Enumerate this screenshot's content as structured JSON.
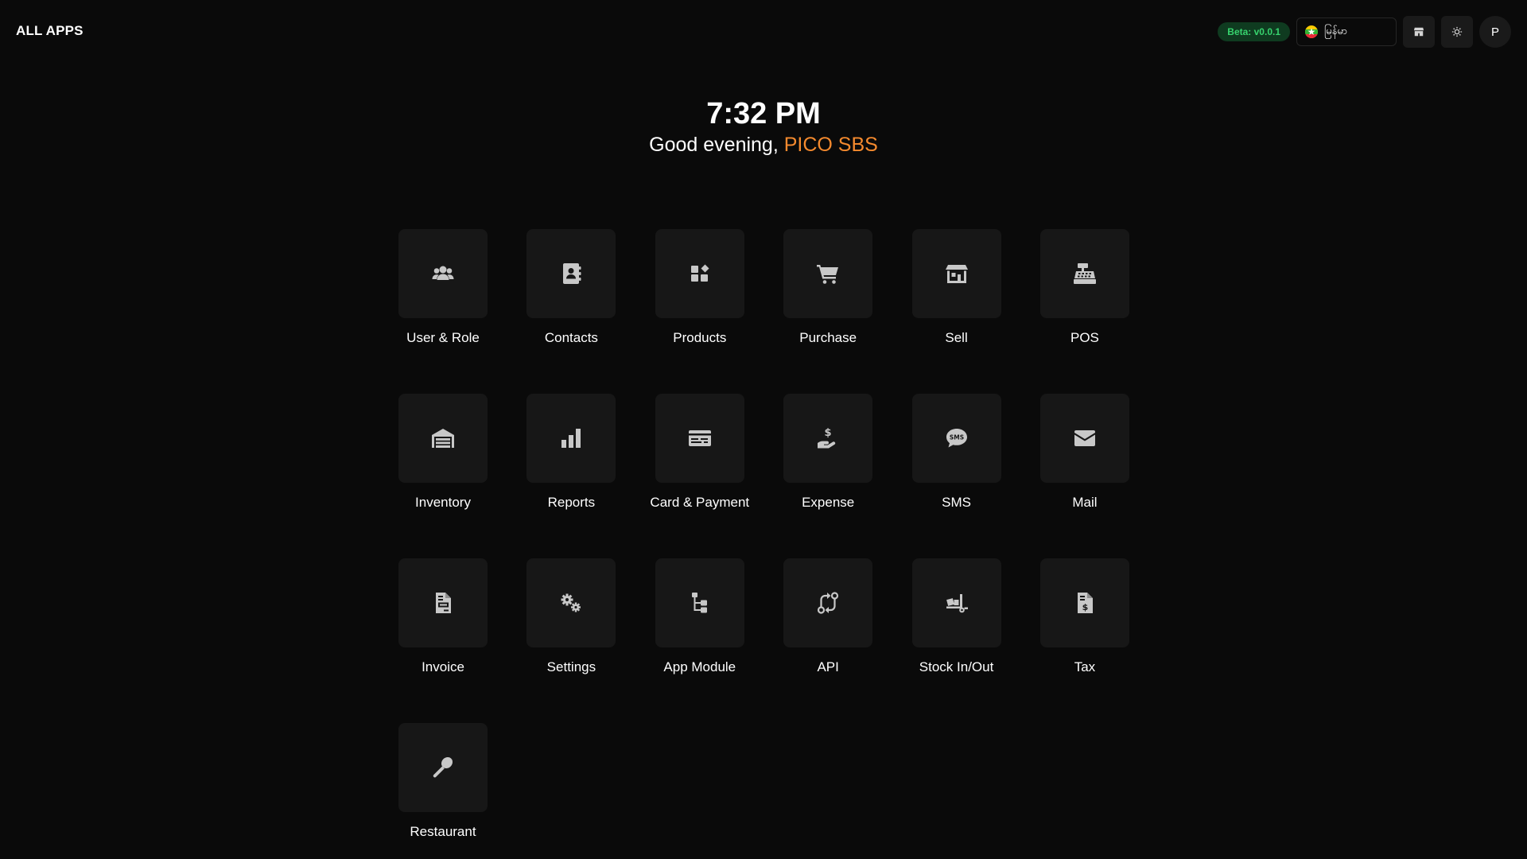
{
  "header": {
    "title": "ALL APPS",
    "beta_label": "Beta: v0.0.1",
    "language": {
      "value": "မြန်မာ",
      "flag_icon": "myanmar-flag-icon"
    },
    "buttons": [
      {
        "icon": "store-icon"
      },
      {
        "icon": "sun-icon"
      }
    ],
    "avatar_initial": "P"
  },
  "hero": {
    "time": "7:32 PM",
    "greeting_prefix": "Good evening, ",
    "org_name": "PICO SBS",
    "org_color": "#f58a2e"
  },
  "apps": [
    {
      "label": "User & Role",
      "icon": "users-icon"
    },
    {
      "label": "Contacts",
      "icon": "address-book-icon"
    },
    {
      "label": "Products",
      "icon": "boxes-icon"
    },
    {
      "label": "Purchase",
      "icon": "cart-icon"
    },
    {
      "label": "Sell",
      "icon": "shop-icon"
    },
    {
      "label": "POS",
      "icon": "cash-register-icon"
    },
    {
      "label": "Inventory",
      "icon": "warehouse-icon"
    },
    {
      "label": "Reports",
      "icon": "bar-chart-icon"
    },
    {
      "label": "Card & Payment",
      "icon": "credit-card-icon"
    },
    {
      "label": "Expense",
      "icon": "hand-dollar-icon"
    },
    {
      "label": "SMS",
      "icon": "sms-icon"
    },
    {
      "label": "Mail",
      "icon": "envelope-icon"
    },
    {
      "label": "Invoice",
      "icon": "invoice-icon"
    },
    {
      "label": "Settings",
      "icon": "gears-icon"
    },
    {
      "label": "App Module",
      "icon": "module-tree-icon"
    },
    {
      "label": "API",
      "icon": "api-icon"
    },
    {
      "label": "Stock In/Out",
      "icon": "truck-loading-icon"
    },
    {
      "label": "Tax",
      "icon": "tax-file-icon"
    },
    {
      "label": "Restaurant",
      "icon": "spoon-icon"
    }
  ]
}
